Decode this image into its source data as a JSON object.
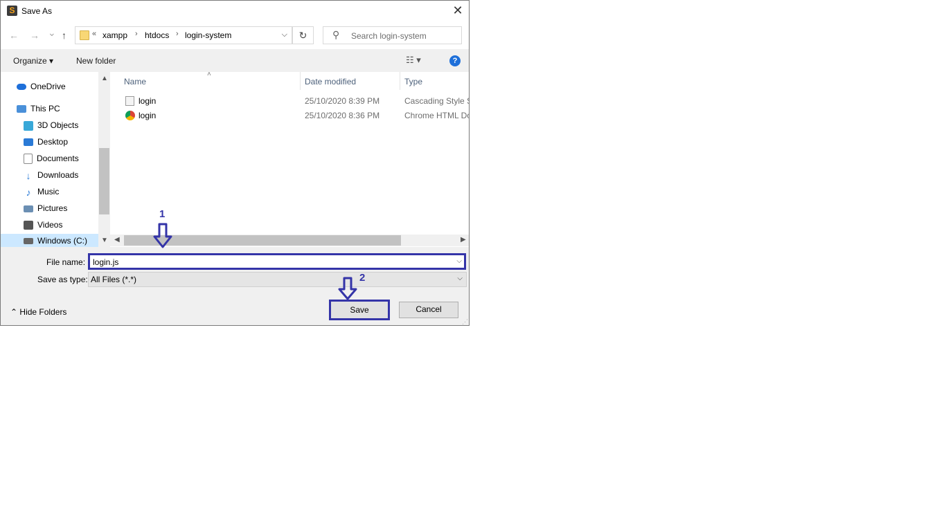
{
  "window": {
    "title": "Save As",
    "close": "✕"
  },
  "nav": {
    "back": "←",
    "forward": "→",
    "recent": "⌄",
    "up": "↑",
    "breadcrumb": [
      "xampp",
      "htdocs",
      "login-system"
    ],
    "overflow": "«",
    "refresh": "↻",
    "search_placeholder": "Search login-system"
  },
  "toolbar": {
    "organize": "Organize ▾",
    "new_folder": "New folder",
    "help": "?"
  },
  "sidebar": {
    "items": [
      {
        "label": "OneDrive",
        "icon": "cloud-icon",
        "color": "#1e6fd9"
      },
      {
        "label": "This PC",
        "icon": "computer-icon",
        "color": "#4a90d9"
      },
      {
        "label": "3D Objects",
        "icon": "cube-icon",
        "color": "#38a8d8"
      },
      {
        "label": "Desktop",
        "icon": "desktop-icon",
        "color": "#2a7ad6"
      },
      {
        "label": "Documents",
        "icon": "document-icon",
        "color": "#8a8a8a"
      },
      {
        "label": "Downloads",
        "icon": "download-icon",
        "color": "#2a7ad6"
      },
      {
        "label": "Music",
        "icon": "music-icon",
        "color": "#2a7ad6"
      },
      {
        "label": "Pictures",
        "icon": "picture-icon",
        "color": "#6b8fb3"
      },
      {
        "label": "Videos",
        "icon": "video-icon",
        "color": "#555555"
      },
      {
        "label": "Windows (C:)",
        "icon": "drive-icon",
        "color": "#666666"
      }
    ]
  },
  "files": {
    "columns": [
      "Name",
      "Date modified",
      "Type"
    ],
    "rows": [
      {
        "name": "login",
        "date": "25/10/2020 8:39 PM",
        "type": "Cascading Style S...",
        "icon": "css-file-icon"
      },
      {
        "name": "login",
        "date": "25/10/2020 8:36 PM",
        "type": "Chrome HTML Do...",
        "icon": "chrome-icon"
      }
    ]
  },
  "form": {
    "file_name_label": "File name:",
    "file_name_value": "login.js",
    "save_type_label": "Save as type:",
    "save_type_value": "All Files (*.*)"
  },
  "footer": {
    "hide_folders": "Hide Folders",
    "save": "Save",
    "cancel": "Cancel"
  },
  "annotations": {
    "step1": "1",
    "step2": "2",
    "color": "#3434a8"
  }
}
